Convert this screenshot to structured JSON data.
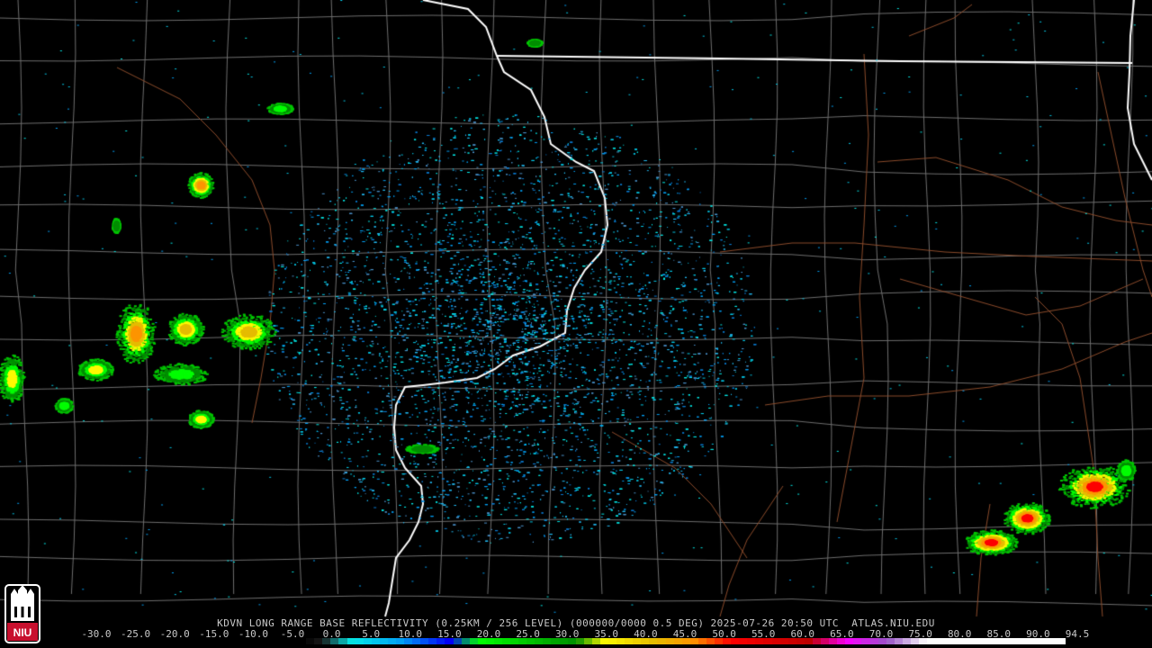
{
  "footer": {
    "title": "KDVN LONG RANGE BASE REFLECTIVITY (0.25KM / 256 LEVEL) (000000/0000 0.5 DEG) 2025-07-26 20:50 UTC  ATLAS.NIU.EDU"
  },
  "logo": {
    "text": "NIU",
    "icon": "university-seal-icon"
  },
  "radar": {
    "site": "KDVN"
  },
  "legend": {
    "labels": [
      "-30.0",
      "-25.0",
      "-20.0",
      "-15.0",
      "-10.0",
      "-5.0",
      "0.0",
      "5.0",
      "10.0",
      "15.0",
      "20.0",
      "25.0",
      "30.0",
      "35.0",
      "40.0",
      "45.0",
      "50.0",
      "55.0",
      "60.0",
      "65.0",
      "70.0",
      "75.0",
      "80.0",
      "85.0",
      "90.0",
      "94.5"
    ],
    "colors": [
      "#000000",
      "#000000",
      "#000000",
      "#000000",
      "#000000",
      "#000000",
      "#0a0a0a",
      "#04e9e7",
      "#019ff4",
      "#0300f4",
      "#02fd02",
      "#01c501",
      "#008e00",
      "#fdf802",
      "#e5bc00",
      "#fd9500",
      "#fd0000",
      "#d40000",
      "#bc0000",
      "#f800fd",
      "#9854c6",
      "#fdfdfd",
      "#fdfdfd",
      "#fdfdfd",
      "#fdfdfd",
      "#fdfdfd"
    ]
  },
  "colors": {
    "background": "#000000",
    "county_lines": "#6e6e6e",
    "state_lines": "#ffffff",
    "highways": "#8b4b2b",
    "label_text": "#c8c8c8",
    "logo_red": "#c8102e"
  }
}
